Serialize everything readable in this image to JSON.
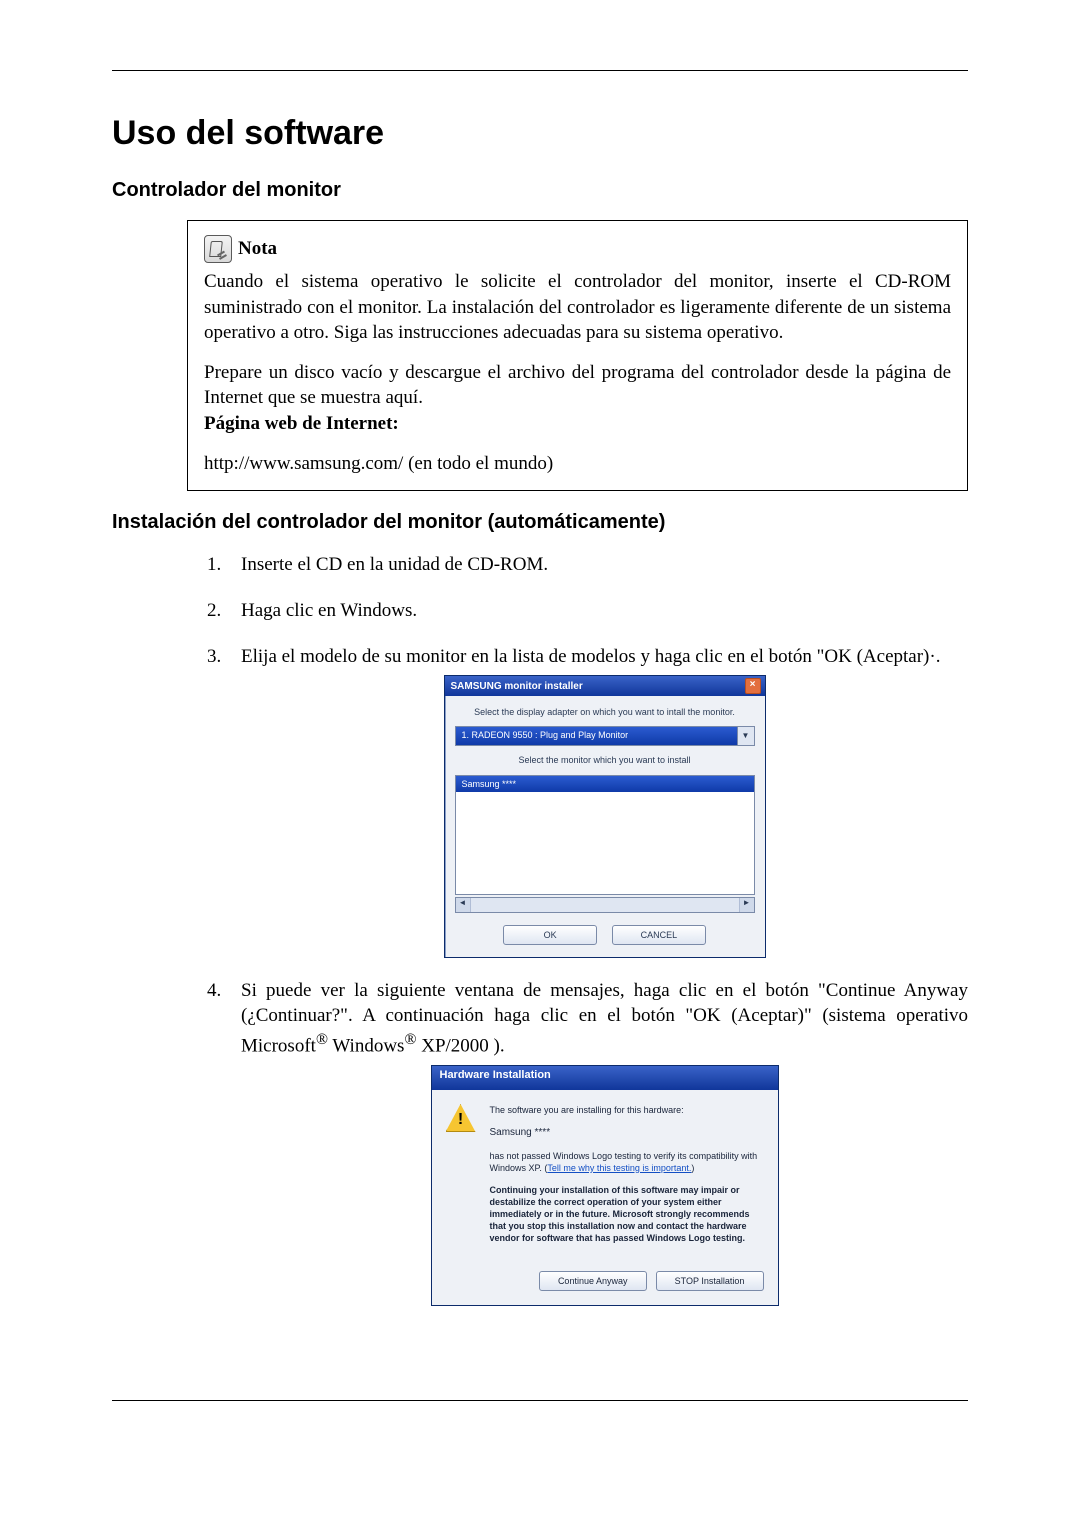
{
  "title": "Uso del software",
  "section1": "Controlador del monitor",
  "nota": {
    "label": "Nota",
    "p1": "Cuando el sistema operativo le solicite el controlador del monitor, inserte el CD-ROM suministrado con el monitor. La instalación del controlador es ligeramente diferente de un sistema operativo a otro. Siga las instrucciones adecuadas para su sistema operativo.",
    "p2": "Prepare un disco vacío y descargue el archivo del programa del controlador desde la página de Internet que se muestra aquí.",
    "site_label": "Página web de Internet:",
    "url": "http://www.samsung.com/ (en todo el mundo)"
  },
  "section2": "Instalación del controlador del monitor (automáticamente)",
  "steps": {
    "s1": "Inserte el CD en la unidad de CD-ROM.",
    "s2": "Haga clic en Windows.",
    "s3": "Elija el modelo de su monitor en la lista de modelos y haga clic en el botón \"OK (Aceptar)·.",
    "s4a": "Si puede ver la siguiente ventana de mensajes, haga clic en el botón \"Continue Anyway (¿Continuar?\". A continuación haga clic en el botón \"OK (Aceptar)\" (sistema operativo Microsoft",
    "s4b": " Windows",
    "s4c": " XP/2000 )."
  },
  "samsung_dlg": {
    "title": "SAMSUNG monitor installer",
    "line1": "Select the display adapter on which you want to intall the monitor.",
    "adapter": "1. RADEON 9550 : Plug and Play Monitor",
    "line2": "Select the monitor which you want to install",
    "model": "Samsung ****",
    "ok": "OK",
    "cancel": "CANCEL"
  },
  "xp_dlg": {
    "title": "Hardware Installation",
    "p1": "The software you are installing for this hardware:",
    "dev": "Samsung ****",
    "p2a": "has not passed Windows Logo testing to verify its compatibility with Windows XP. (",
    "link": "Tell me why this testing is important.",
    "p2b": ")",
    "p3": "Continuing your installation of this software may impair or destabilize the correct operation of your system either immediately or in the future. Microsoft strongly recommends that you stop this installation now and contact the hardware vendor for software that has passed Windows Logo testing.",
    "btn_continue": "Continue Anyway",
    "btn_stop": "STOP Installation"
  }
}
